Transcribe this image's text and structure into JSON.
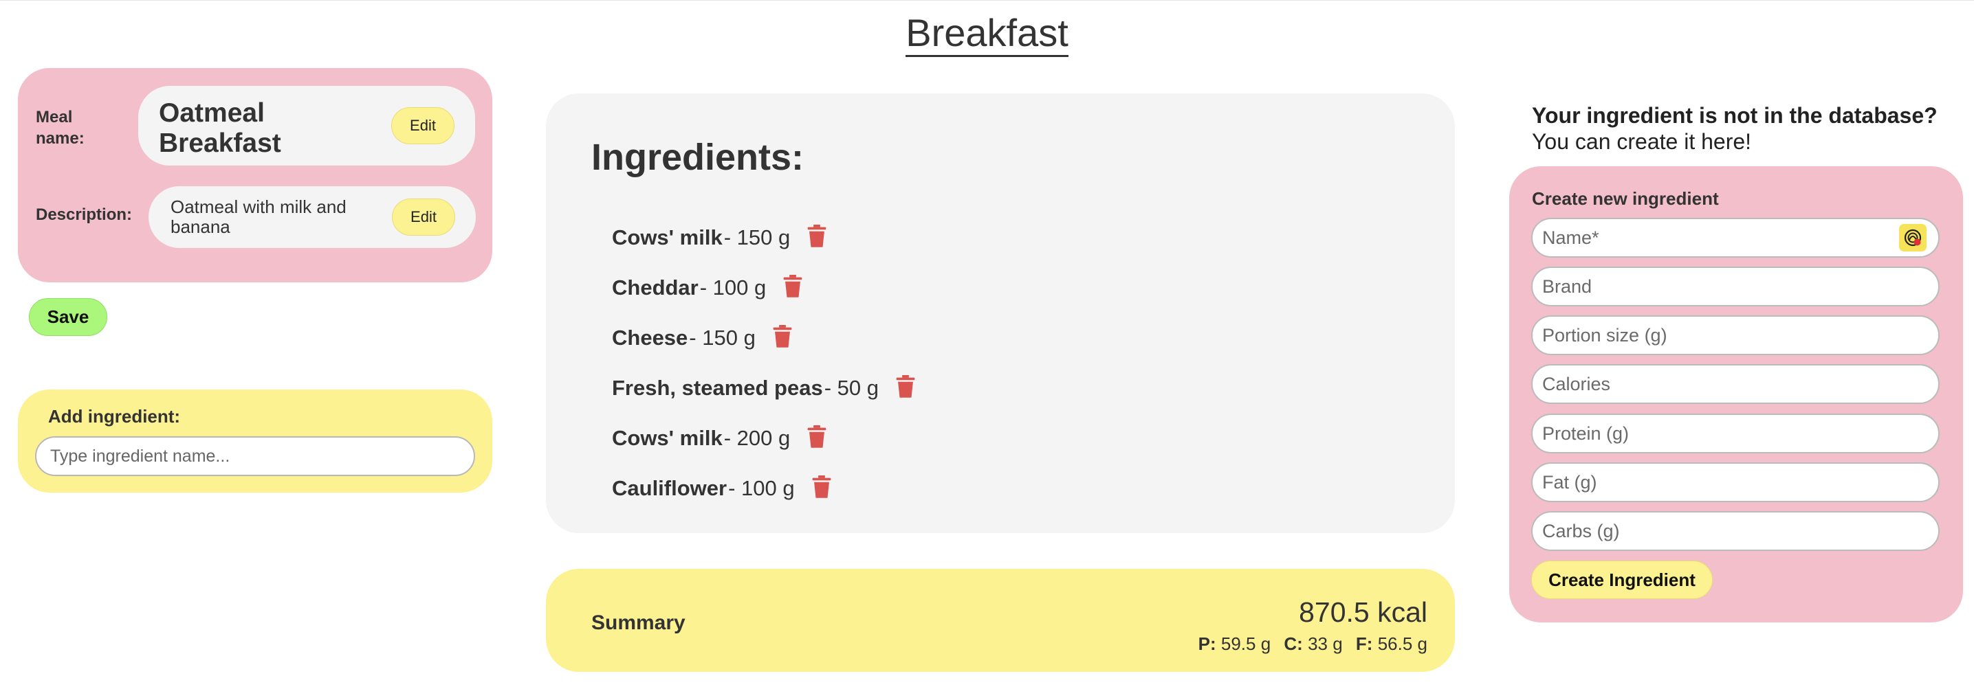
{
  "page": {
    "title": "Breakfast"
  },
  "meal": {
    "name_label": "Meal name:",
    "name_value": "Oatmeal Breakfast",
    "description_label": "Description:",
    "description_value": "Oatmeal with milk and banana",
    "edit_label": "Edit",
    "save_label": "Save"
  },
  "add_ingredient": {
    "title": "Add ingredient:",
    "placeholder": "Type ingredient name..."
  },
  "ingredients": {
    "title": "Ingredients:",
    "items": [
      {
        "name": "Cows' milk",
        "qty": "- 150 g"
      },
      {
        "name": "Cheddar",
        "qty": "- 100 g"
      },
      {
        "name": "Cheese",
        "qty": "- 150 g"
      },
      {
        "name": "Fresh, steamed peas",
        "qty": "- 50 g"
      },
      {
        "name": "Cows' milk",
        "qty": "- 200 g"
      },
      {
        "name": "Cauliflower",
        "qty": "- 100 g"
      }
    ],
    "delete_icon": "trash-icon",
    "delete_color": "#d9534f"
  },
  "summary": {
    "title": "Summary",
    "kcal": "870.5 kcal",
    "protein_label": "P:",
    "protein_value": "59.5 g",
    "carbs_label": "C:",
    "carbs_value": "33 g",
    "fat_label": "F:",
    "fat_value": "56.5 g"
  },
  "create_ingredient": {
    "promo_question": "Your ingredient is not in the database?",
    "promo_answer": "You can create it here!",
    "title": "Create new ingredient",
    "fields": {
      "name": "Name*",
      "brand": "Brand",
      "portion": "Portion size (g)",
      "calories": "Calories",
      "protein": "Protein (g)",
      "fat": "Fat (g)",
      "carbs": "Carbs (g)"
    },
    "autofill_icon": "autofill-icon",
    "button_label": "Create Ingredient"
  },
  "colors": {
    "pink": "#f2bfcb",
    "yellow": "#fcf292",
    "green": "#aaf77c",
    "light_gray": "#f4f4f4",
    "danger": "#d9534f"
  }
}
